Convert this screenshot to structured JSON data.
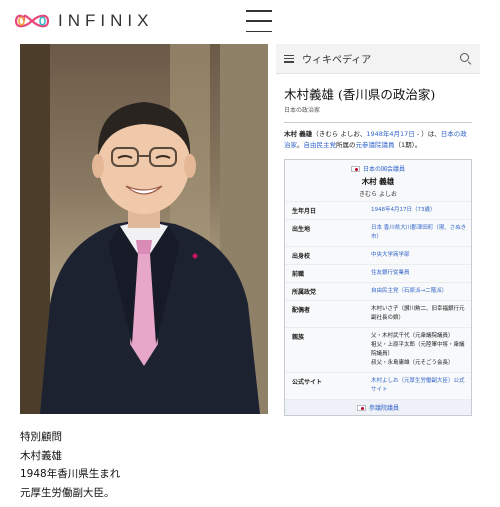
{
  "header": {
    "logo_text": "INFINIX",
    "logo_colors": [
      "#e64a7b",
      "#f3a53b",
      "#7a4fd6",
      "#2fb6c9"
    ]
  },
  "caption": {
    "line1": "特別顧問",
    "line2": "木村義雄",
    "line3": "1948年香川県生まれ",
    "line4": "元厚生労働副大臣。"
  },
  "wiki": {
    "brand": "ウィキペディア",
    "title": "木村義雄 (香川県の政治家)",
    "subtitle": "日本の政治家",
    "lead_name": "木村 義雄",
    "lead_reading": "（きむら よしお、",
    "lead_date": "1948年4月17日",
    "lead_mid": " - ）は、",
    "lead_link1": "日本の政治家",
    "lead_mid2": "。",
    "lead_link2": "自由民主党",
    "lead_mid3": "所属の",
    "lead_link3": "元参議院議員",
    "lead_end": "（1期）。",
    "infobox": {
      "house": "日本の国会議員",
      "name": "木村 義雄",
      "kana": "きむら よしお",
      "rows": [
        {
          "key": "生年月日",
          "value": "1948年4月17日（73歳）"
        },
        {
          "key": "出生地",
          "value": "日本 香川県大川郡津田町（現、さぬき市）"
        },
        {
          "key": "出身校",
          "value": "中央大学商学部"
        },
        {
          "key": "前職",
          "value": "住友銀行従業員"
        },
        {
          "key": "所属政党",
          "value": "自由民主党（石原派→二階派）"
        },
        {
          "key": "配偶者",
          "value": "木村いさ子（讃川勲二、旧幸福銀行元副社長の娘）"
        },
        {
          "key": "親族",
          "value": "父・木村武千代（元衆議院議員）\n祖父・上原平太郎（元陸軍中将・衆議院議員）\n叔父・永島庸雄（元そごう会長）"
        },
        {
          "key": "公式サイト",
          "value": "木村よしお（元厚生労働副大臣）公式サイト"
        }
      ],
      "footer": "参議院議員"
    }
  }
}
